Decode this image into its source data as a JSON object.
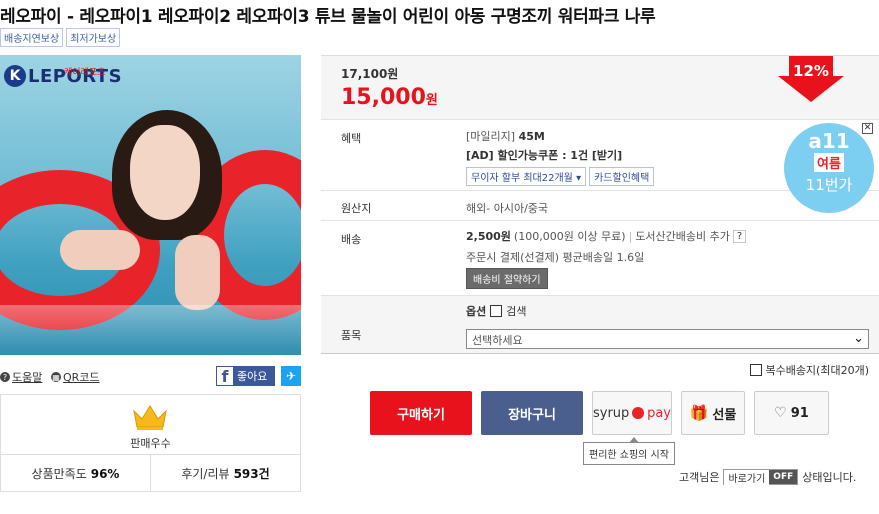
{
  "title": "레오파이 - 레오파이1 레오파이2 레오파이3 튜브 물놀이 어린이 아동 구명조끼 워터파크 나루",
  "tags": [
    "배송지연보상",
    "최저가보상"
  ],
  "image": {
    "logo_letter": "K",
    "logo_text": "LEPORTS",
    "logo_sub": "케이레포츠"
  },
  "util": {
    "help": "도움말",
    "qr": "QR코드",
    "like": "좋아요",
    "help_icon": "question-icon"
  },
  "seller": {
    "grade": "판매우수",
    "satisfaction_label": "상품만족도",
    "satisfaction_value": "96%",
    "review_label": "후기/리뷰",
    "review_value": "593건"
  },
  "price": {
    "original": "17,100원",
    "sale": "15,000",
    "unit": "원",
    "discount": "12%"
  },
  "benefit": {
    "label": "혜택",
    "mileage": "[마일리지]",
    "mileage_value": "45M",
    "coupon": "[AD] 할인가능쿠폰 : 1건 [받기]",
    "installment": "무이자 할부 최대22개월",
    "card": "카드할인혜택"
  },
  "badge": {
    "a": "a11",
    "b": "여름",
    "c": "11번가"
  },
  "origin": {
    "label": "원산지",
    "value": "해외- 아시아/중국"
  },
  "shipping": {
    "label": "배송",
    "fee": "2,500원",
    "free_cond": "(100,000원 이상 무료)",
    "extra": "도서산간배송비 추가",
    "extra_help": "?",
    "note": "주문시 결제(선결제) 평균배송일 1.6일",
    "save_btn": "배송비 절약하기"
  },
  "product": {
    "label": "품목",
    "option_label": "옵션",
    "search_label": "검색",
    "select_value": "선택하세요"
  },
  "multi_ship": "복수배송지(최대20개)",
  "actions": {
    "buy": "구매하기",
    "cart": "장바구니",
    "syrup": "syrup",
    "pay": "pay",
    "gift": "선물",
    "like_count": "91",
    "tooltip": "편리한 쇼핑의 시작"
  },
  "status": {
    "prefix": "고객님은",
    "shortcut": "바로가기",
    "off": "OFF",
    "suffix": "상태입니다."
  }
}
